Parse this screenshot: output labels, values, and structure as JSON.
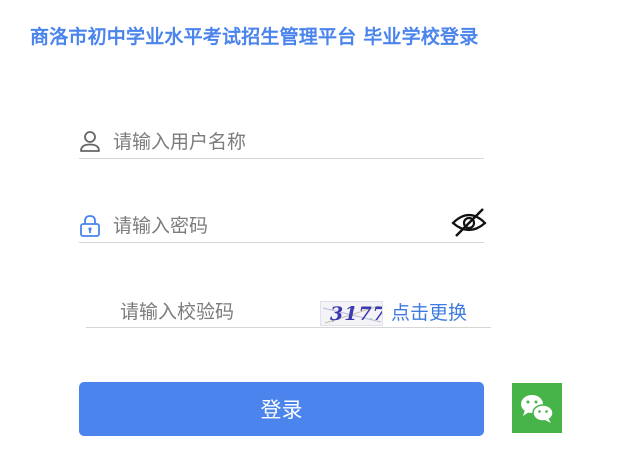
{
  "page": {
    "title": "商洛市初中学业水平考试招生管理平台 毕业学校登录"
  },
  "form": {
    "username": {
      "placeholder": "请输入用户名称",
      "value": "",
      "icon": "user-icon"
    },
    "password": {
      "placeholder": "请输入密码",
      "value": "",
      "icon": "lock-icon",
      "toggle_icon": "eye-off-icon"
    },
    "captcha": {
      "placeholder": "请输入校验码",
      "value": "",
      "code": "3177",
      "refresh_label": "点击更换"
    },
    "submit_label": "登录"
  },
  "wechat": {
    "icon": "wechat-icon",
    "color": "#46b449"
  },
  "colors": {
    "accent": "#4a84ec",
    "link": "#3f7be0"
  }
}
